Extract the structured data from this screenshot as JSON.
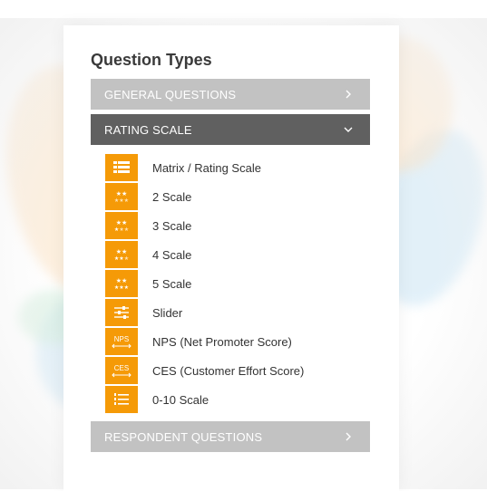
{
  "panel": {
    "title": "Question Types"
  },
  "accordion": {
    "general": {
      "label": "GENERAL QUESTIONS",
      "state": "collapsed"
    },
    "rating": {
      "label": "RATING SCALE",
      "state": "expanded"
    },
    "respondent": {
      "label": "RESPONDENT QUESTIONS",
      "state": "collapsed"
    }
  },
  "rating_items": [
    {
      "label": "Matrix / Rating Scale",
      "icon": "matrix-grid-icon"
    },
    {
      "label": "2 Scale",
      "icon": "two-star-scale-icon"
    },
    {
      "label": "3 Scale",
      "icon": "three-star-scale-icon"
    },
    {
      "label": "4 Scale",
      "icon": "four-star-scale-icon"
    },
    {
      "label": "5 Scale",
      "icon": "five-star-scale-icon"
    },
    {
      "label": "Slider",
      "icon": "slider-icon"
    },
    {
      "label": "NPS (Net Promoter Score)",
      "icon": "nps-icon",
      "icon_text": "NPS"
    },
    {
      "label": "CES (Customer Effort Score)",
      "icon": "ces-icon",
      "icon_text": "CES"
    },
    {
      "label": "0-10 Scale",
      "icon": "numbered-list-icon"
    }
  ],
  "colors": {
    "icon_bg": "#f59a07",
    "header_collapsed": "#c2c2c2",
    "header_expanded": "#606060"
  }
}
